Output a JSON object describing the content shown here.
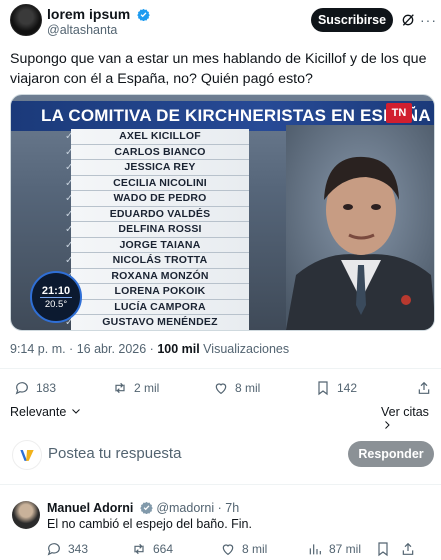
{
  "author": {
    "name": "lorem ipsum",
    "handle": "@altashanta"
  },
  "header": {
    "subscribe_label": "Suscribirse",
    "more_label": "···"
  },
  "tweet": {
    "text": "Supongo que van a estar un mes hablando de Kicillof y de los que viajaron con él a España, no? Quién pagó esto?"
  },
  "media": {
    "banner": "LA COMITIVA DE KIRCHNERISTAS EN ESPAÑA",
    "logo": "TN",
    "names": [
      "AXEL KICILLOF",
      "CARLOS BIANCO",
      "JESSICA REY",
      "CECILIA NICOLINI",
      "WADO DE PEDRO",
      "EDUARDO VALDÉS",
      "DELFINA ROSSI",
      "JORGE TAIANA",
      "NICOLÁS TROTTA",
      "ROXANA MONZÓN",
      "LORENA POKOIK",
      "LUCÍA CAMPORA",
      "GUSTAVO MENÉNDEZ"
    ],
    "clock_time": "21:10",
    "clock_temp": "20.5°"
  },
  "meta": {
    "time_date": "9:14 p. m. · 16 abr. 2026 · ",
    "views_count": "100 mil",
    "views_label": " Visualizaciones"
  },
  "stats": {
    "replies": "183",
    "reposts": "2 mil",
    "likes": "8 mil",
    "bookmarks": "142"
  },
  "sort": {
    "relevant": "Relevante",
    "quotes": "Ver citas"
  },
  "composer": {
    "placeholder": "Postea tu respuesta",
    "reply_label": "Responder"
  },
  "reply": {
    "name": "Manuel Adorni",
    "handle_time": "@madorni · 7h",
    "text": "El no cambió el espejo del baño. Fin.",
    "replies": "343",
    "reposts": "664",
    "likes": "8 mil",
    "views": "87 mil"
  },
  "colors": {
    "accent": "#1d9bf0",
    "text": "#0f1419",
    "muted": "#536471"
  }
}
